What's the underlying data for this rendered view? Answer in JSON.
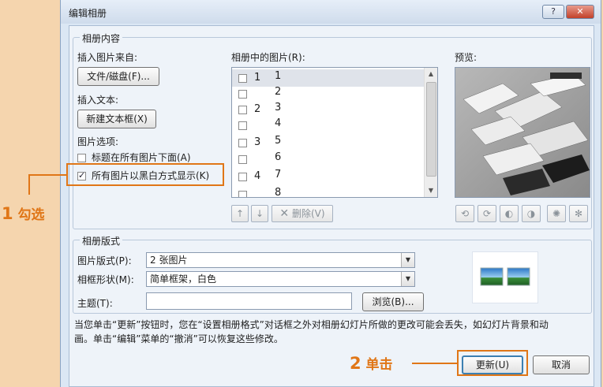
{
  "dialog": {
    "title": "编辑相册",
    "help_label": "?",
    "close_label": "✕"
  },
  "album_content": {
    "group_label": "相册内容",
    "insert_from_label": "插入图片来自:",
    "file_button": "文件/磁盘(F)...",
    "insert_text_label": "插入文本:",
    "new_textbox_button": "新建文本框(X)",
    "picture_options_label": "图片选项:",
    "caption_option": {
      "label": "标题在所有图片下面(A)",
      "checked": false
    },
    "bw_option": {
      "label": "所有图片以黑白方式显示(K)",
      "checked": true
    }
  },
  "pictures_list": {
    "label": "相册中的图片(R):",
    "rows": [
      {
        "group": "1",
        "num": "1",
        "selected": true
      },
      {
        "group": "",
        "num": "2",
        "selected": false
      },
      {
        "group": "2",
        "num": "3",
        "selected": false
      },
      {
        "group": "",
        "num": "4",
        "selected": false
      },
      {
        "group": "3",
        "num": "5",
        "selected": false
      },
      {
        "group": "",
        "num": "6",
        "selected": false
      },
      {
        "group": "4",
        "num": "7",
        "selected": false
      },
      {
        "group": "",
        "num": "8",
        "selected": false
      }
    ],
    "move_up_icon": "arrow-up-icon",
    "move_down_icon": "arrow-down-icon",
    "delete_label": "删除(V)"
  },
  "preview": {
    "label": "预览:",
    "tool_icons": [
      "rotate-left-icon",
      "rotate-right-icon",
      "contrast-up-icon",
      "contrast-down-icon",
      "brightness-up-icon",
      "brightness-down-icon"
    ]
  },
  "album_layout": {
    "group_label": "相册版式",
    "picture_layout_label": "图片版式(P):",
    "picture_layout_value": "2 张图片",
    "frame_shape_label": "相框形状(M):",
    "frame_shape_value": "简单框架，白色",
    "theme_label": "主题(T):",
    "theme_value": "",
    "browse_button": "浏览(B)..."
  },
  "notice": {
    "line1": "当您单击“更新”按钮时，您在“设置相册格式”对话框之外对相册幻灯片所做的更改可能会丢失，如幻灯片背景和动",
    "line2": "画。单击“编辑”菜单的“撤消”可以恢复这些修改。"
  },
  "footer": {
    "update_button": "更新(U)",
    "cancel_button": "取消"
  },
  "annotations": {
    "step1_number": "1",
    "step1_text": "勾选",
    "step2_number": "2",
    "step2_text": "单击",
    "color": "#e07617"
  }
}
